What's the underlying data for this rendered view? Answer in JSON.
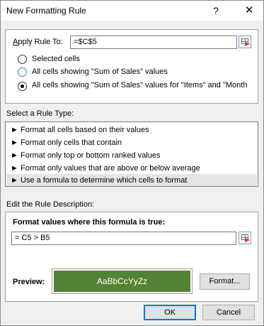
{
  "window": {
    "title": "New Formatting Rule",
    "help": "?",
    "close": "✕"
  },
  "apply_rule": {
    "label": "Apply Rule To:",
    "value": "=$C$5",
    "options": [
      {
        "label": "Selected cells",
        "checked": false
      },
      {
        "label": "All cells showing \"Sum of Sales\" values",
        "checked": false
      },
      {
        "label": "All cells showing \"Sum of Sales\" values for \"Items\" and \"Month",
        "checked": true
      }
    ]
  },
  "rule_type": {
    "label": "Select a Rule Type:",
    "bullet": "►",
    "items": [
      {
        "label": "Format all cells based on their values",
        "selected": false
      },
      {
        "label": "Format only cells that contain",
        "selected": false
      },
      {
        "label": "Format only top or bottom ranked values",
        "selected": false
      },
      {
        "label": "Format only values that are above or below average",
        "selected": false
      },
      {
        "label": "Use a formula to determine which cells to format",
        "selected": true
      }
    ]
  },
  "description": {
    "label": "Edit the Rule Description:",
    "formula_label": "Format values where this formula is true:",
    "formula_value": "= C5 > B5",
    "preview_label": "Preview:",
    "preview_text": "AaBbCcYyZz",
    "preview_fill": "#548235",
    "format_button": "Format..."
  },
  "buttons": {
    "ok": "OK",
    "cancel": "Cancel"
  }
}
